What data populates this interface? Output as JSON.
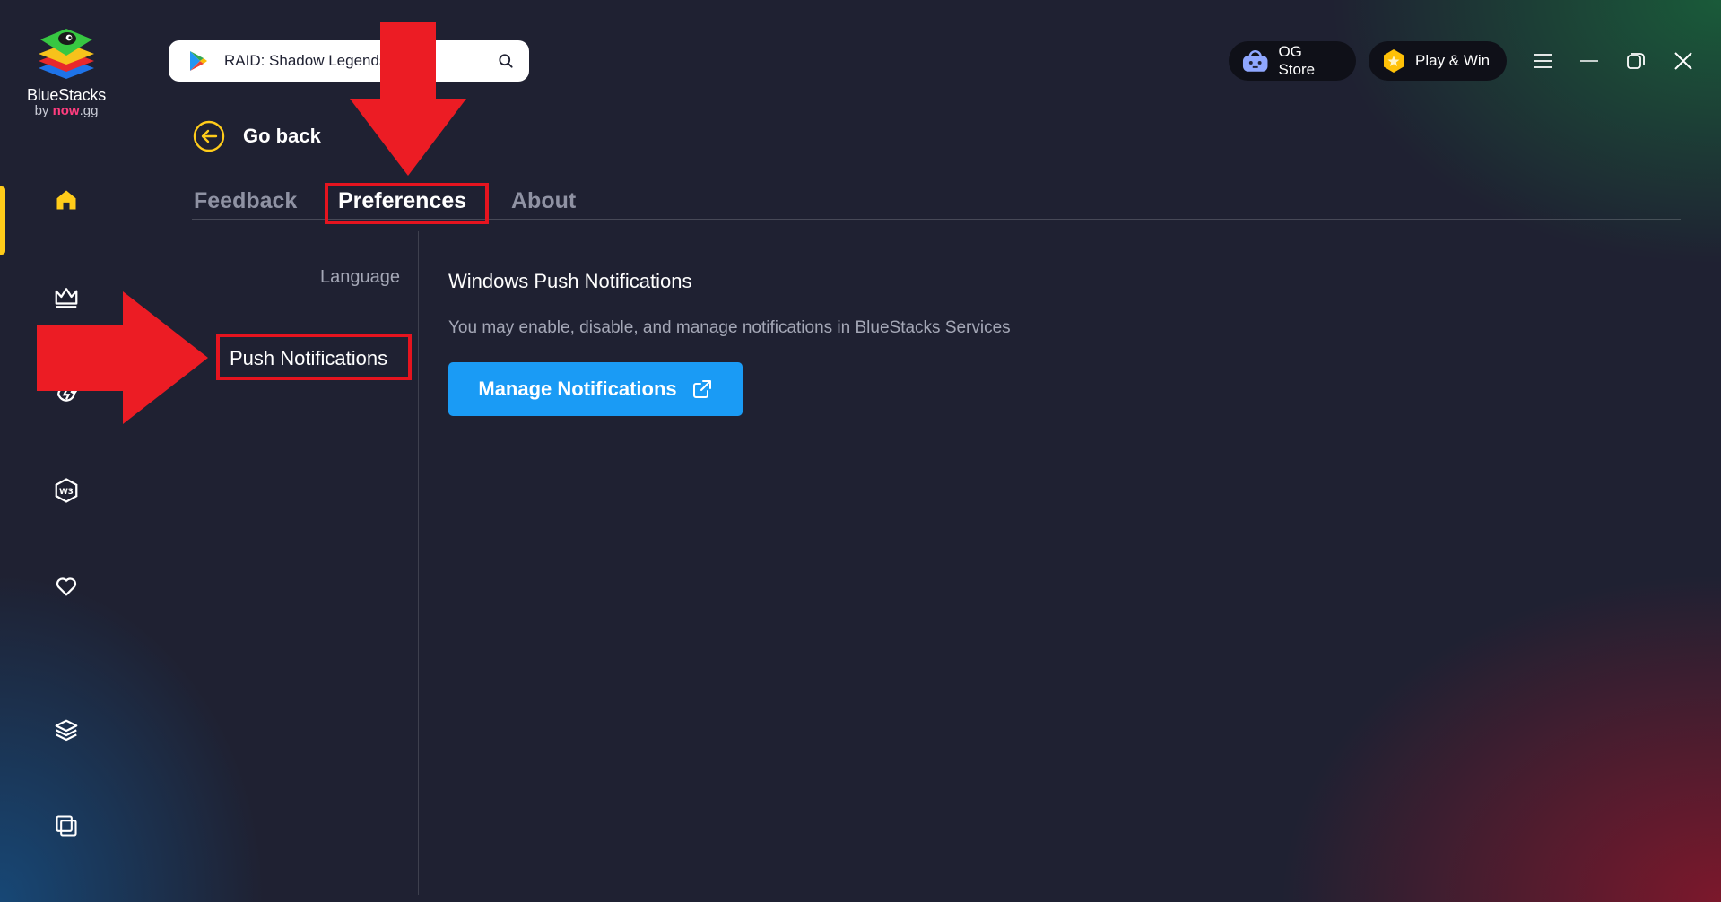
{
  "brand": {
    "name": "BlueStacks",
    "by": "by",
    "sub_brand": "now",
    "sub_suffix": ".gg"
  },
  "search": {
    "value": "RAID: Shadow Legends",
    "icon": "search-icon"
  },
  "header": {
    "og_store_label": "OG Store",
    "play_win_label": "Play & Win"
  },
  "sidebar": {
    "items": [
      {
        "name": "home",
        "icon": "home-icon",
        "active": true
      },
      {
        "name": "crown",
        "icon": "crown-icon"
      },
      {
        "name": "sync",
        "icon": "cloud-sync-icon"
      },
      {
        "name": "w3",
        "icon": "w3-badge-icon"
      },
      {
        "name": "favorites",
        "icon": "heart-icon"
      },
      {
        "name": "layers",
        "icon": "layers-icon"
      },
      {
        "name": "multi-instance",
        "icon": "multi-window-icon"
      }
    ]
  },
  "nav": {
    "go_back_label": "Go back"
  },
  "tabs": [
    {
      "label": "Feedback",
      "active": false
    },
    {
      "label": "Preferences",
      "active": true
    },
    {
      "label": "About",
      "active": false
    }
  ],
  "menu": {
    "items": [
      {
        "label": "Language",
        "active": false
      },
      {
        "label": "Push Notifications",
        "active": true
      }
    ]
  },
  "content": {
    "title": "Windows Push Notifications",
    "description": "You may enable, disable, and manage notifications in BlueStacks Services",
    "button_label": "Manage Notifications"
  },
  "colors": {
    "background": "#1f2132",
    "accent_blue": "#1a9bf5",
    "active_yellow": "#ffcc1a",
    "annotation_red": "#e5141f"
  }
}
